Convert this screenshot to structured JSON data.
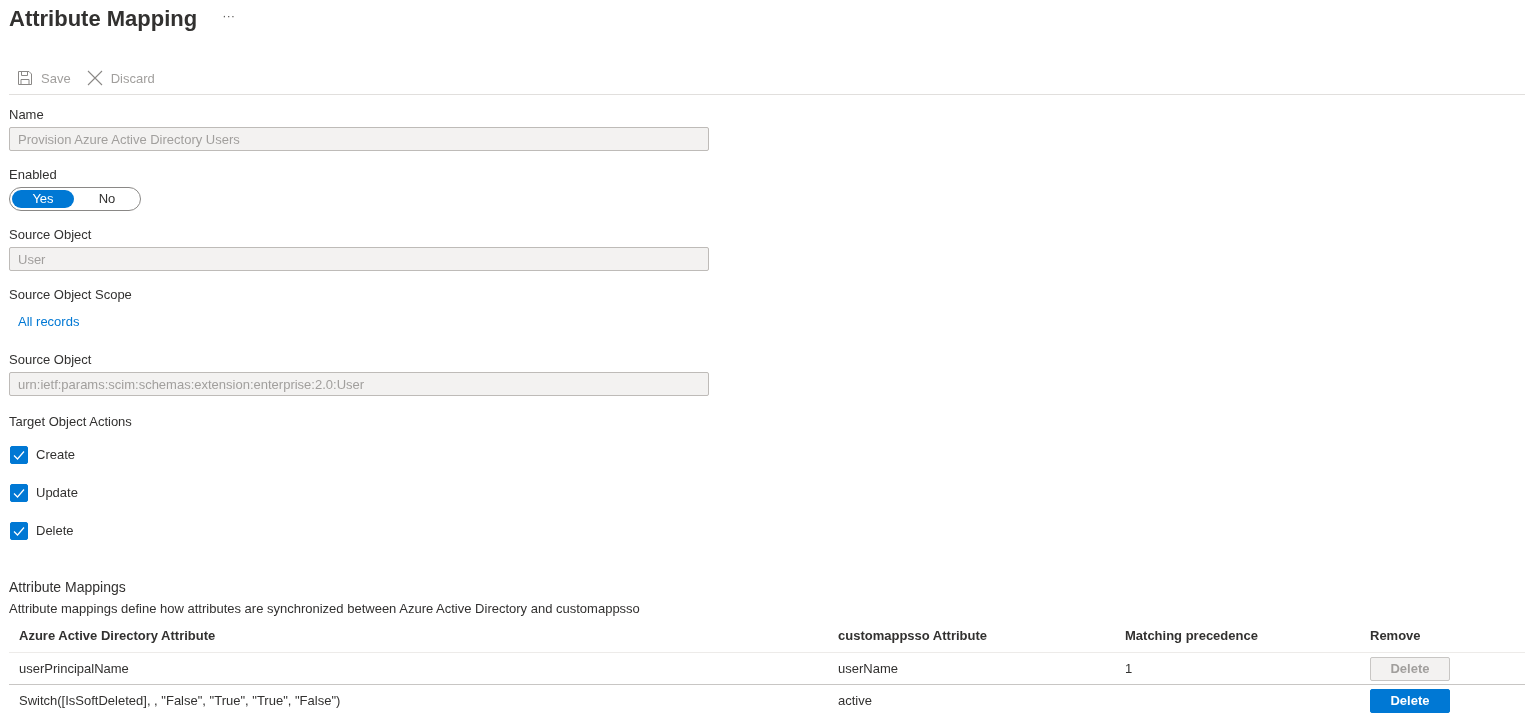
{
  "page": {
    "title": "Attribute Mapping",
    "more": "···"
  },
  "toolbar": [
    {
      "kind": "save",
      "label": "Save",
      "disabled": true
    },
    {
      "kind": "discard",
      "label": "Discard",
      "disabled": true
    }
  ],
  "form": [
    {
      "kind": "text",
      "label": "Name",
      "value": "Provision Azure Active Directory Users",
      "disabled": true
    },
    {
      "kind": "toggle",
      "label": "Enabled",
      "options": [
        {
          "label": "Yes",
          "selected": true
        },
        {
          "label": "No",
          "selected": false
        }
      ]
    },
    {
      "kind": "text",
      "label": "Source Object",
      "value": "User",
      "disabled": true
    },
    {
      "kind": "link",
      "label": "Source Object Scope",
      "link": "All records"
    },
    {
      "kind": "text",
      "label": "Source Object",
      "value": "urn:ietf:params:scim:schemas:extension:enterprise:2.0:User",
      "disabled": true
    },
    {
      "kind": "checkboxes",
      "label": "Target Object Actions",
      "items": [
        {
          "label": "Create",
          "checked": true
        },
        {
          "label": "Update",
          "checked": true
        },
        {
          "label": "Delete",
          "checked": true
        }
      ]
    }
  ],
  "mappings": {
    "title": "Attribute Mappings",
    "description": "Attribute mappings define how attributes are synchronized between Azure Active Directory and customappsso",
    "columns": [
      "Azure Active Directory Attribute",
      "customappsso Attribute",
      "Matching precedence",
      "Remove"
    ],
    "rows": [
      {
        "azure_active_directory_attribute": "userPrincipalName",
        "customappsso_attribute": "userName",
        "matching_precedence": "1",
        "remove": {
          "label": "Delete",
          "disabled": true
        }
      },
      {
        "azure_active_directory_attribute": "Switch([IsSoftDeleted], , \"False\", \"True\", \"True\", \"False\")",
        "customappsso_attribute": "active",
        "remove": {
          "label": "Delete",
          "disabled": false
        }
      }
    ]
  }
}
